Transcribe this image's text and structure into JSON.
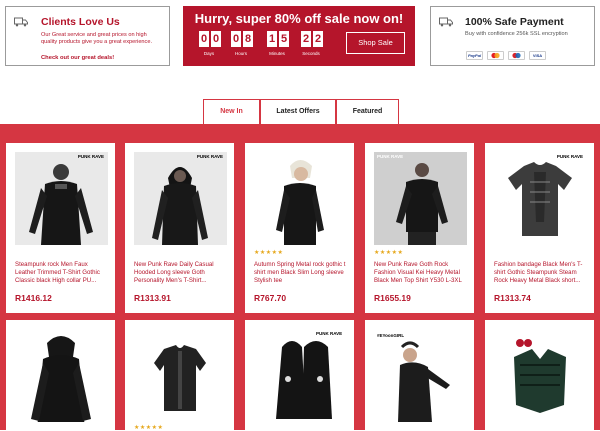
{
  "promo_left": {
    "title": "Clients Love Us",
    "text": "Our Great service and great prices on high quality products give you a great experience.",
    "link": "Check out our great deals!"
  },
  "sale": {
    "title": "Hurry, super 80% off sale now on!",
    "digits": [
      "0",
      "0",
      "0",
      "8",
      "1",
      "5",
      "2",
      "2"
    ],
    "units": [
      "Days",
      "Hours",
      "Minutes",
      "Seconds"
    ],
    "button": "Shop Sale"
  },
  "promo_right": {
    "title": "100% Safe Payment",
    "text": "Buy with confidence 256k SSL encryption",
    "payment_icons": [
      "PayPal",
      "mastercard",
      "maestro",
      "VISA"
    ]
  },
  "tabs": [
    "New In",
    "Latest Offers",
    "Featured"
  ],
  "active_tab": "New In",
  "products": [
    {
      "name": "Steampunk rock Men Faux Leather Trimmed T-Shirt Gothic Classic black High collar PU...",
      "price": "R1416.12",
      "brand": "PUNK RAVE",
      "stars": ""
    },
    {
      "name": "New Punk Rave Daily Casual Hooded Long sleeve Goth Personality Men's T-Shirt...",
      "price": "R1313.91",
      "brand": "PUNK RAVE",
      "stars": ""
    },
    {
      "name": "Autumn Spring Metal rock gothic t shirt men Black Slim Long sleeve Stylish tee",
      "price": "R767.70",
      "brand": "",
      "stars": "★★★★★"
    },
    {
      "name": "New Punk Rave Goth Rock Fashion Visual Kei Heavy Metal Black Men Top Shirt Y530 L-3XL",
      "price": "R1655.19",
      "brand": "PUNK RAVE",
      "stars": "★★★★★"
    },
    {
      "name": "Fashion bandage Black Men's T-shirt Gothic Steampunk Steam Rock Heavy Metal Black short...",
      "price": "R1313.74",
      "brand": "PUNK RAVE",
      "stars": ""
    },
    {
      "name": "",
      "price": "",
      "brand": "",
      "stars": ""
    },
    {
      "name": "",
      "price": "",
      "brand": "PUNK RAVE",
      "stars": "★★★★★"
    },
    {
      "name": "",
      "price": "",
      "brand": "",
      "stars": ""
    },
    {
      "name": "",
      "price": "",
      "brand": "#EYoonGIRL",
      "stars": ""
    },
    {
      "name": "",
      "price": "",
      "brand": "",
      "stars": ""
    }
  ],
  "colors": {
    "accent": "#b5152b",
    "band": "#d53642",
    "stars": "#e6a81d"
  }
}
